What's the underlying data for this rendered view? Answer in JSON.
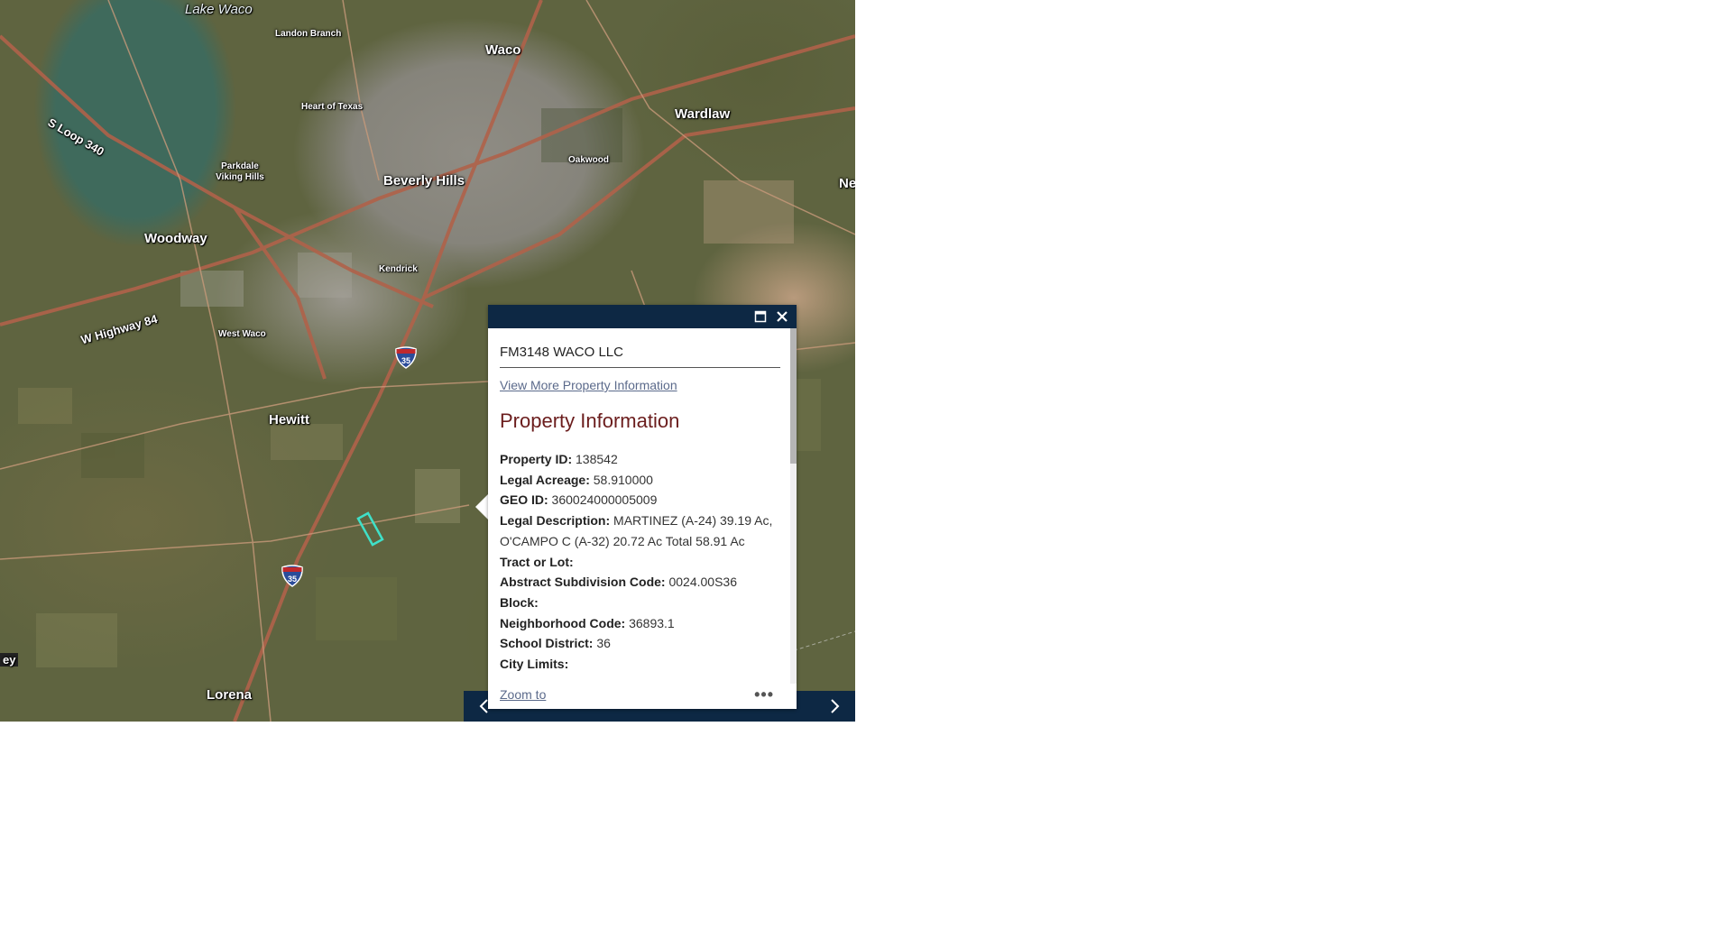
{
  "map": {
    "labels": [
      {
        "text": "Lake Waco",
        "kind": "water"
      },
      {
        "text": "Landon Branch",
        "kind": "sm"
      },
      {
        "text": "Waco",
        "kind": "lg"
      },
      {
        "text": "Wardlaw",
        "kind": "lg"
      },
      {
        "text": "S Loop 340",
        "kind": "md"
      },
      {
        "text": "Heart of Texas",
        "kind": "sm"
      },
      {
        "text": "Oakwood",
        "kind": "sm"
      },
      {
        "text": "Parkdale Viking Hills",
        "kind": "sm"
      },
      {
        "text": "Beverly Hills",
        "kind": "lg"
      },
      {
        "text": "Ne",
        "kind": "lg"
      },
      {
        "text": "Woodway",
        "kind": "lg"
      },
      {
        "text": "Kendrick",
        "kind": "sm"
      },
      {
        "text": "W Highway 84",
        "kind": "md"
      },
      {
        "text": "West Waco",
        "kind": "sm"
      },
      {
        "text": "Hewitt",
        "kind": "lg"
      },
      {
        "text": "Lorena",
        "kind": "lg"
      },
      {
        "text": "ey",
        "kind": "md"
      }
    ],
    "shields": [
      "35",
      "35"
    ],
    "parcel_color": "#3fe0c8"
  },
  "popup": {
    "owner": "FM3148 WACO LLC",
    "link_text": "View More Property Information",
    "section_title": "Property Information",
    "fields": [
      {
        "label": "Property ID:",
        "value": " 138542"
      },
      {
        "label": "Legal Acreage:",
        "value": " 58.910000"
      },
      {
        "label": "GEO ID:",
        "value": " 360024000005009"
      },
      {
        "label": "Legal Description:",
        "value": " MARTINEZ (A-24) 39.19 Ac, O'CAMPO C (A-32) 20.72 Ac Total 58.91 Ac"
      },
      {
        "label": "Tract or Lot:",
        "value": ""
      },
      {
        "label": "Abstract Subdivision Code:",
        "value": " 0024.00S36"
      },
      {
        "label": "Block:",
        "value": ""
      },
      {
        "label": "Neighborhood Code:",
        "value": " 36893.1"
      },
      {
        "label": "School District:",
        "value": " 36"
      },
      {
        "label": "City Limits:",
        "value": ""
      }
    ],
    "zoom_label": "Zoom to",
    "more_label": "•••",
    "maximize_icon": "maximize-icon",
    "close_icon": "close-icon"
  },
  "pager": {
    "prev_icon": "chevron-left-icon",
    "next_icon": "chevron-right-icon"
  }
}
